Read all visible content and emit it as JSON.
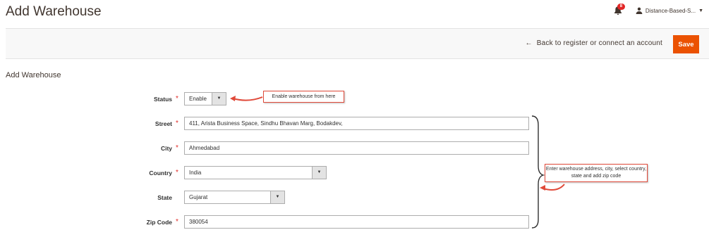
{
  "page": {
    "title": "Add Warehouse"
  },
  "header": {
    "notification_count": "8",
    "user_name": "Distance-Based-S...",
    "user_caret": "▼"
  },
  "actions": {
    "back_arrow": "←",
    "back_label": "Back to register or connect an account",
    "save_label": "Save"
  },
  "section": {
    "title": "Add Warehouse"
  },
  "form": {
    "required_mark": "*",
    "status": {
      "label": "Status",
      "value": "Enable"
    },
    "street": {
      "label": "Street",
      "value": "411, Arista Business Space, Sindhu Bhavan Marg, Bodakdev,"
    },
    "city": {
      "label": "City",
      "value": "Ahmedabad"
    },
    "country": {
      "label": "Country",
      "value": "India"
    },
    "state": {
      "label": "State",
      "value": "Gujarat"
    },
    "zip": {
      "label": "Zip Code",
      "value": "380054"
    },
    "select_arrow": "▼"
  },
  "annotations": {
    "status_note": "Enable warehouse from here",
    "address_note": "Enter warehouse address, city, select country, state and add zip code"
  },
  "colors": {
    "save_button": "#eb5202",
    "required": "#e02b27",
    "callout_border": "#e04a3a",
    "badge": "#e22626"
  },
  "icons": {
    "notification": "bell-icon",
    "user": "user-icon",
    "back": "arrow-left-icon"
  }
}
